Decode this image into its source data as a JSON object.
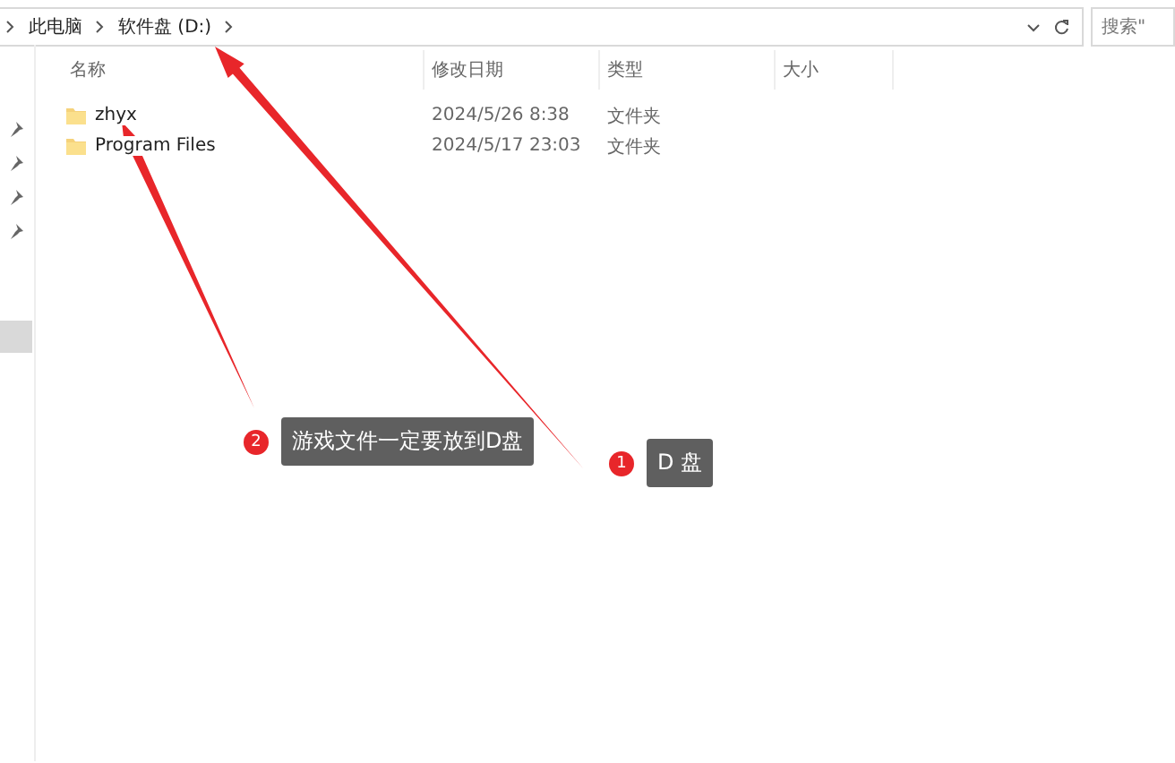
{
  "address_bar": {
    "path": [
      "此电脑",
      "软件盘 (D:)"
    ]
  },
  "search": {
    "placeholder": "搜索\""
  },
  "table": {
    "columns": [
      "名称",
      "修改日期",
      "类型",
      "大小"
    ],
    "rows": [
      {
        "name": "zhyx",
        "modified": "2024/5/26 8:38",
        "type": "文件夹"
      },
      {
        "name": "Program Files",
        "modified": "2024/5/17 23:03",
        "type": "文件夹"
      }
    ]
  },
  "annotations": [
    {
      "number": "1",
      "text": "D 盘"
    },
    {
      "number": "2",
      "text": "游戏文件一定要放到D盘"
    }
  ]
}
